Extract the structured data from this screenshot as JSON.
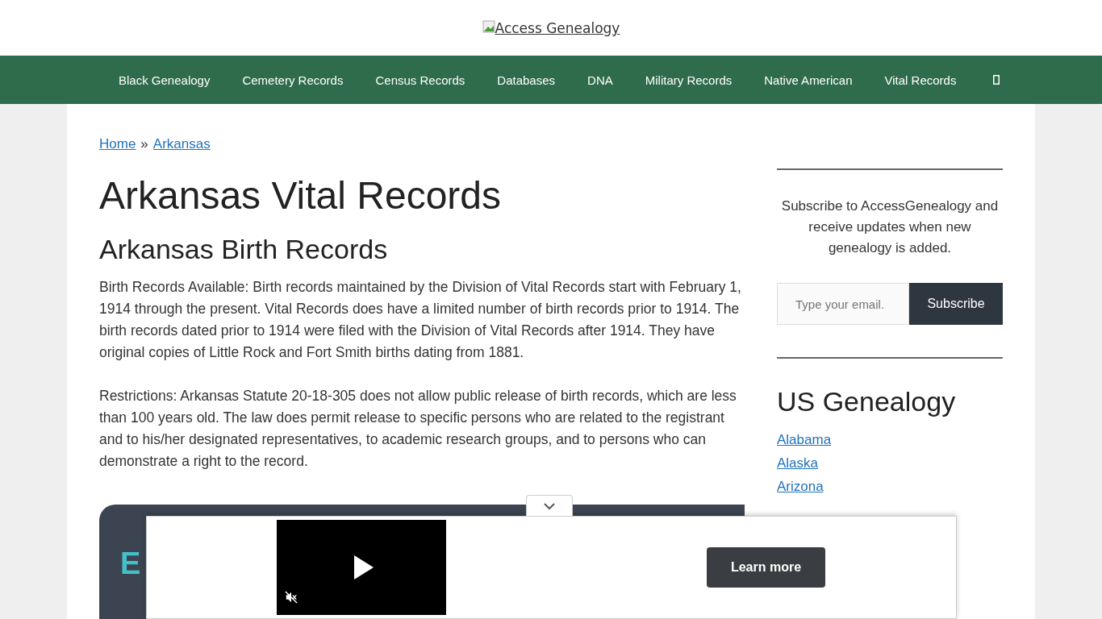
{
  "header": {
    "logo_alt": "Access Genealogy"
  },
  "nav": {
    "items": [
      "Black Genealogy",
      "Cemetery Records",
      "Census Records",
      "Databases",
      "DNA",
      "Military Records",
      "Native American",
      "Vital Records"
    ]
  },
  "breadcrumb": [
    "Home",
    "Arkansas"
  ],
  "breadcrumb_separator": "»",
  "title": "Arkansas Vital Records",
  "section_heading": "Arkansas Birth Records",
  "paragraphs": [
    "Birth Records Available: Birth records maintained by the Division of Vital Records start with February 1, 1914 through the present. Vital Records does have a limited number of birth records prior to 1914. The birth records dated prior to 1914 were filed with the Division of Vital Records after 1914. They have original copies of Little Rock and Fort Smith births dating from 1881.",
    "Restrictions: Arkansas Statute 20-18-305 does not allow public release of birth records, which are less than 100 years old. The law does permit release to specific persons who are related to the registrant and to his/her designated representatives, to academic research groups, and to persons who can demonstrate a right to the record."
  ],
  "card_heading": "E",
  "sidebar": {
    "subscribe_text": "Subscribe to AccessGenealogy and receive updates when new genealogy is added.",
    "email_placeholder": "Type your email.",
    "subscribe_button": "Subscribe",
    "heading": "US Genealogy",
    "links": [
      "Alabama",
      "Alaska",
      "Arizona"
    ]
  },
  "ad": {
    "button": "Learn more"
  }
}
